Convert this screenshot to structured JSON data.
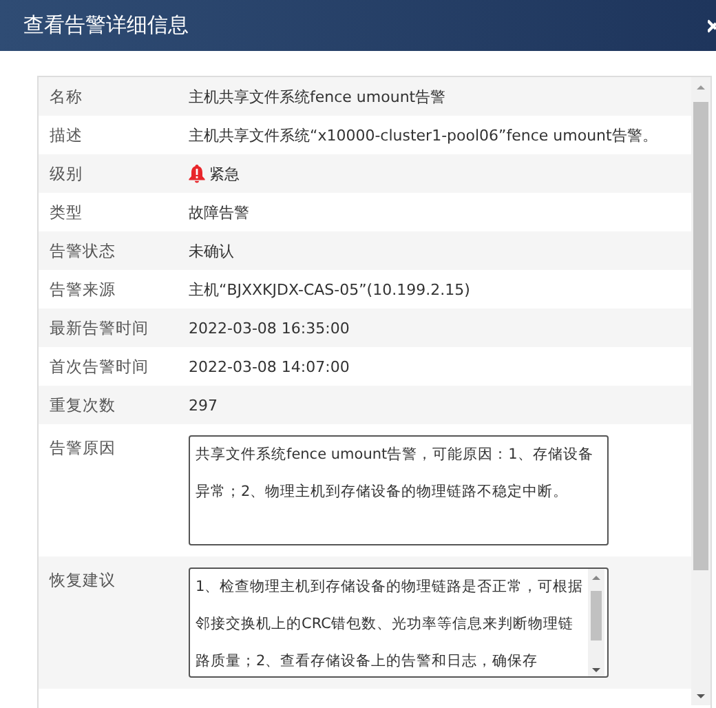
{
  "window": {
    "title": "查看告警详细信息"
  },
  "rows": [
    {
      "kind": "text",
      "label": "名称",
      "value": "主机共享文件系统fence umount告警"
    },
    {
      "kind": "text",
      "label": "描述",
      "value": "主机共享文件系统“x10000-cluster1-pool06”fence umount告警。"
    },
    {
      "kind": "severity",
      "label": "级别",
      "value": "紧急"
    },
    {
      "kind": "text",
      "label": "类型",
      "value": "故障告警"
    },
    {
      "kind": "text",
      "label": "告警状态",
      "value": "未确认"
    },
    {
      "kind": "text",
      "label": "告警来源",
      "value": "主机“BJXXKJDX-CAS-05”(10.199.2.15)"
    },
    {
      "kind": "text",
      "label": "最新告警时间",
      "value": "2022-03-08 16:35:00"
    },
    {
      "kind": "text",
      "label": "首次告警时间",
      "value": "2022-03-08 14:07:00"
    },
    {
      "kind": "text",
      "label": "重复次数",
      "value": "297"
    },
    {
      "kind": "textarea",
      "label": "告警原因",
      "value": "共享文件系统fence umount告警，可能原因：1、存储设备异常；2、物理主机到存储设备的物理链路不稳定中断。"
    },
    {
      "kind": "scrolltextarea",
      "label": "恢复建议",
      "value": "1、检查物理主机到存储设备的物理链路是否正常，可根据邻接交换机上的CRC错包数、光功率等信息来判断物理链路质量；2、查看存储设备上的告警和日志，确保存"
    }
  ]
}
